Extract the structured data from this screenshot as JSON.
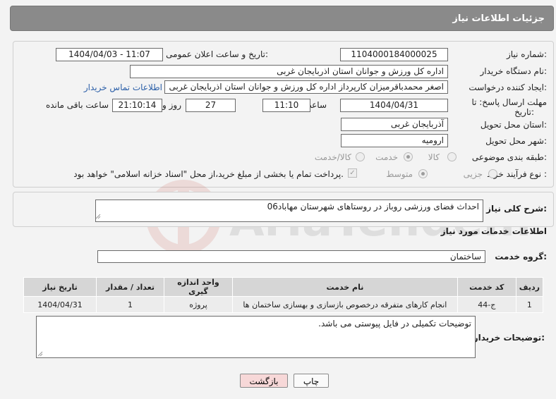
{
  "header": {
    "title": "جزئیات اطلاعات نیاز"
  },
  "form": {
    "need_number_label": "شماره نیاز:",
    "need_number": "1104000184000025",
    "announce_label": "تاریخ و ساعت اعلان عمومی:",
    "announce_value": "1404/04/03 - 11:07",
    "buyer_org_label": "نام دستگاه خریدار:",
    "buyer_org": "اداره کل ورزش و جوانان استان اذربایجان غربی",
    "requester_label": "ایجاد کننده درخواست:",
    "requester": "اصغر محمدباقرمیزان کارپرداز اداره کل ورزش و جوانان استان اذربایجان غربی",
    "contact_link": "اطلاعات تماس خریدار",
    "deadline_label_1": "مهلت ارسال پاسخ: تا",
    "deadline_label_2": "تاریخ:",
    "deadline_date": "1404/04/31",
    "time_label": "ساعت",
    "deadline_time": "11:10",
    "days_value": "27",
    "days_label": "روز و",
    "remaining_time": "21:10:14",
    "remaining_label": "ساعت باقی مانده",
    "province_label": "استان محل تحویل:",
    "province": "آذربایجان غربی",
    "city_label": "شهر محل تحویل:",
    "city": "ارومیه",
    "category_label": "طبقه بندی موضوعی:",
    "category_options": [
      "کالا",
      "خدمت",
      "کالا/خدمت"
    ],
    "category_selected": "خدمت",
    "process_label": "نوع فرآیند خرید :",
    "process_options": [
      "جزیی",
      "متوسط"
    ],
    "process_selected": "متوسط",
    "payment_note": "پرداخت تمام یا بخشی از مبلغ خرید،از محل \"اسناد خزانه اسلامی\" خواهد بود."
  },
  "summary": {
    "label": "شرح کلی نیاز:",
    "value": "احداث فضای ورزشی روباز در روستاهای شهرستان مهاباد06"
  },
  "services": {
    "section_title": "اطلاعات خدمات مورد نیاز",
    "group_label": "گروه خدمت:",
    "group_value": "ساختمان",
    "table": {
      "headers": [
        "ردیف",
        "کد خدمت",
        "نام خدمت",
        "واحد اندازه گیری",
        "تعداد / مقدار",
        "تاریخ نیاز"
      ],
      "rows": [
        [
          "1",
          "ج-44",
          "انجام کارهای متفرقه درخصوص بازسازی و بهسازی ساختمان ها",
          "پروژه",
          "1",
          "1404/04/31"
        ]
      ]
    }
  },
  "buyer_notes": {
    "label": "توضیحات خریدار:",
    "value": "توضیحات تکمیلی در فایل پیوستی می باشد."
  },
  "buttons": {
    "print": "چاپ",
    "back": "بازگشت"
  },
  "watermark": {
    "text": "AriaTender.neT"
  },
  "colors": {
    "header_bg": "#8a8a8a",
    "link": "#2b5fa8",
    "back_btn_bg": "#f7d8d8"
  }
}
